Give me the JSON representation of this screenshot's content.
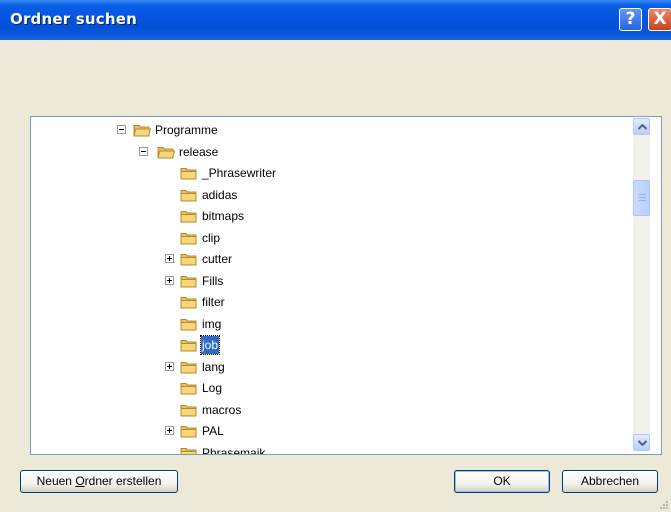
{
  "window": {
    "title": "Ordner suchen"
  },
  "titlebar": {
    "help_glyph": "?",
    "close_glyph": "X"
  },
  "tree": {
    "items": [
      {
        "label": "Programme",
        "level": 0,
        "expander": "minus",
        "selected": false
      },
      {
        "label": "release",
        "level": 1,
        "expander": "minus",
        "selected": false
      },
      {
        "label": "_Phrasewriter",
        "level": 2,
        "expander": "none",
        "selected": false
      },
      {
        "label": "adidas",
        "level": 2,
        "expander": "none",
        "selected": false
      },
      {
        "label": "bitmaps",
        "level": 2,
        "expander": "none",
        "selected": false
      },
      {
        "label": "clip",
        "level": 2,
        "expander": "none",
        "selected": false
      },
      {
        "label": "cutter",
        "level": 2,
        "expander": "plus",
        "selected": false
      },
      {
        "label": "Fills",
        "level": 2,
        "expander": "plus",
        "selected": false
      },
      {
        "label": "filter",
        "level": 2,
        "expander": "none",
        "selected": false
      },
      {
        "label": "img",
        "level": 2,
        "expander": "none",
        "selected": false
      },
      {
        "label": "job",
        "level": 2,
        "expander": "none",
        "selected": true
      },
      {
        "label": "lang",
        "level": 2,
        "expander": "plus",
        "selected": false
      },
      {
        "label": "Log",
        "level": 2,
        "expander": "none",
        "selected": false
      },
      {
        "label": "macros",
        "level": 2,
        "expander": "none",
        "selected": false
      },
      {
        "label": "PAL",
        "level": 2,
        "expander": "plus",
        "selected": false
      },
      {
        "label": "Phrasemaik...",
        "level": 2,
        "expander": "none",
        "selected": false
      }
    ]
  },
  "buttons": {
    "new_folder_label": "Neuen Ordner erstellen",
    "new_folder_prefix": "Neuen ",
    "new_folder_mnemonic": "O",
    "new_folder_suffix": "rdner erstellen",
    "ok_label": "OK",
    "cancel_label": "Abbrechen"
  },
  "colors": {
    "titlebar": "#0554E0",
    "selection": "#316AC5",
    "dialog_bg": "#ECE9D8",
    "folder_fill": "#F6D77E",
    "folder_stroke": "#B38B2C"
  },
  "icons": {
    "folder": "folder-icon",
    "expand": "plus-box-icon",
    "collapse": "minus-box-icon",
    "scroll_up": "chevron-up-icon",
    "scroll_down": "chevron-down-icon",
    "help": "help-icon",
    "close": "close-icon"
  }
}
